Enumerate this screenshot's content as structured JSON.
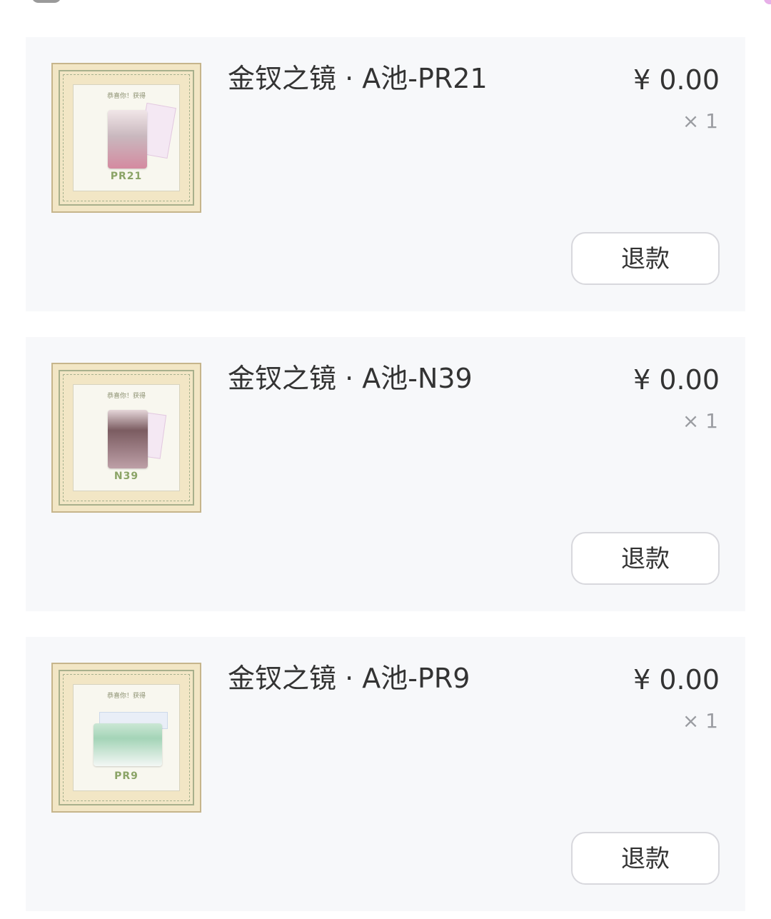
{
  "orders": [
    {
      "thumbnail": {
        "heading": "恭喜你！获得",
        "code": "PR21"
      },
      "title": "金钗之镜 · A池-PR21",
      "price": "¥ 0.00",
      "quantity": "× 1",
      "refund_label": "退款"
    },
    {
      "thumbnail": {
        "heading": "恭喜你！获得",
        "code": "N39"
      },
      "title": "金钗之镜 · A池-N39",
      "price": "¥ 0.00",
      "quantity": "× 1",
      "refund_label": "退款"
    },
    {
      "thumbnail": {
        "heading": "恭喜你！获得",
        "code": "PR9"
      },
      "title": "金钗之镜 · A池-PR9",
      "price": "¥ 0.00",
      "quantity": "× 1",
      "refund_label": "退款"
    }
  ],
  "colors": {
    "page_background": "#ffffff",
    "card_background": "#f7f8fa",
    "primary_text": "#333333",
    "secondary_text": "#9a9ca1",
    "button_border": "#d8d8dd"
  }
}
